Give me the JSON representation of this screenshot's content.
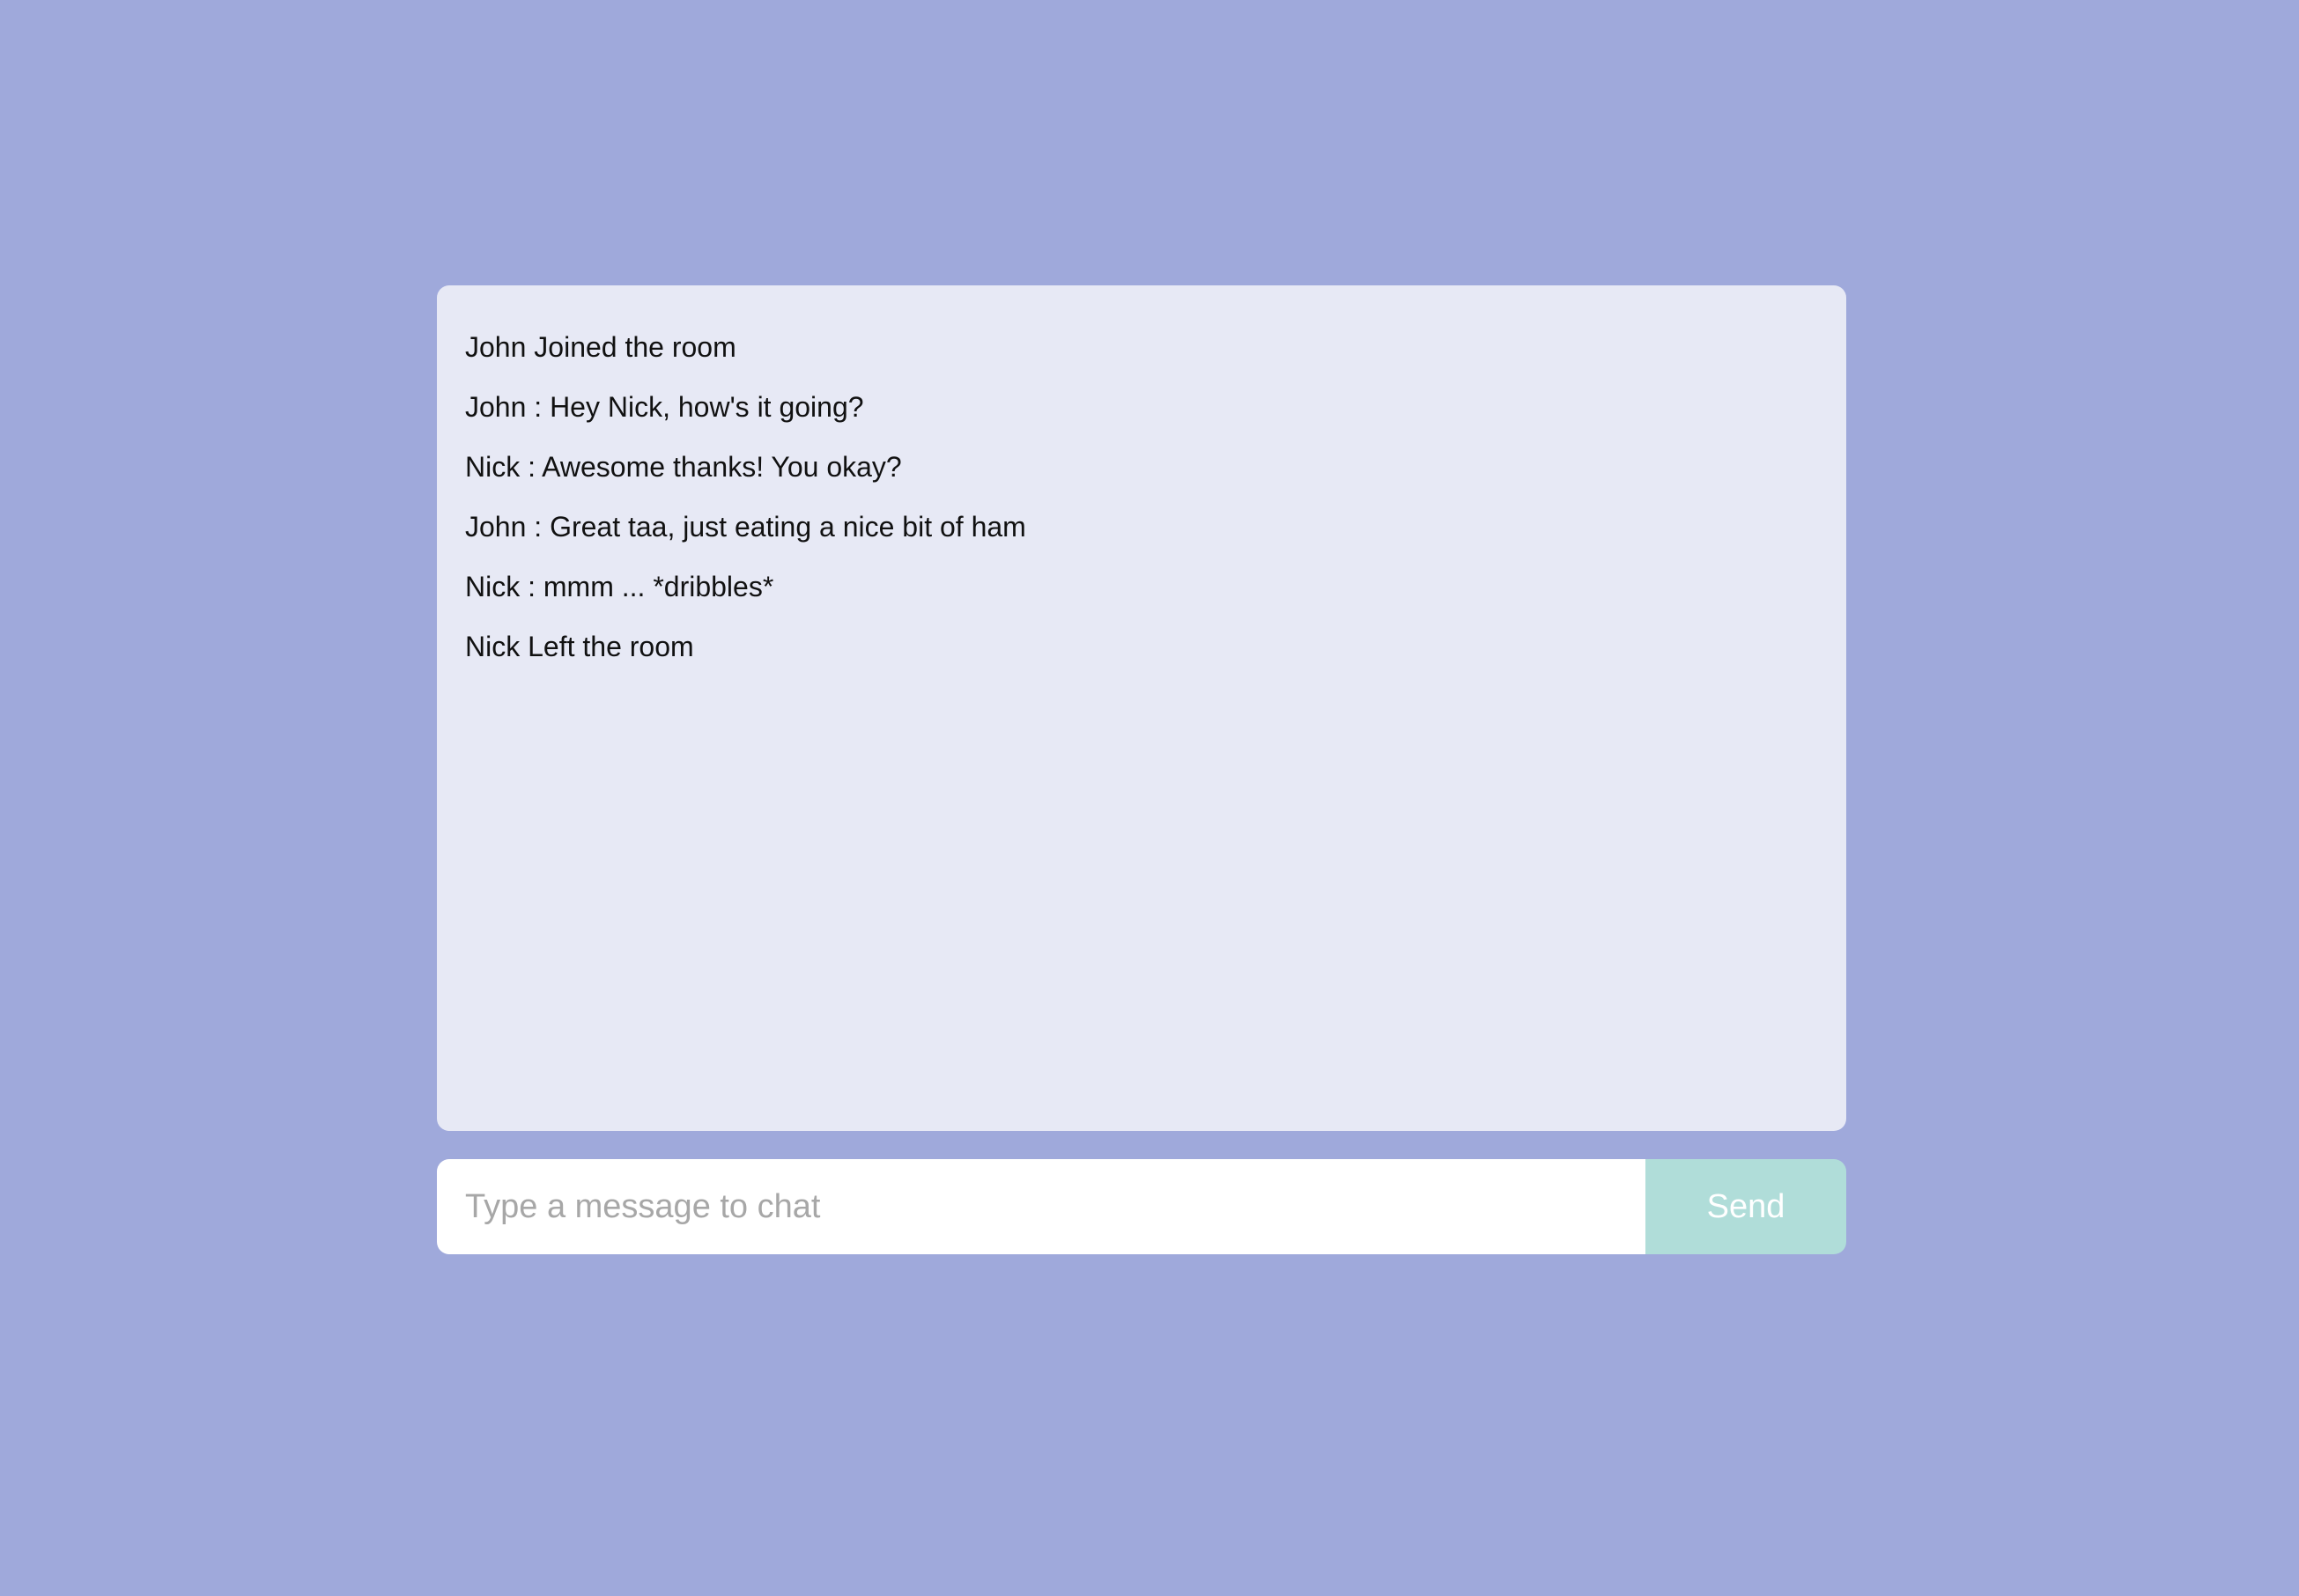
{
  "theme": {
    "background": "#9fa9db",
    "panel_background": "#e7e9f5",
    "send_button_color": "#b0ddd9"
  },
  "chat": {
    "messages": [
      "John Joined the room",
      "John : Hey Nick, how's it going?",
      "Nick : Awesome thanks! You okay?",
      "John : Great taa, just eating a nice bit of ham",
      "Nick : mmm ... *dribbles*",
      "Nick Left the room"
    ]
  },
  "composer": {
    "placeholder": "Type a message to chat",
    "value": "",
    "send_label": "Send"
  }
}
